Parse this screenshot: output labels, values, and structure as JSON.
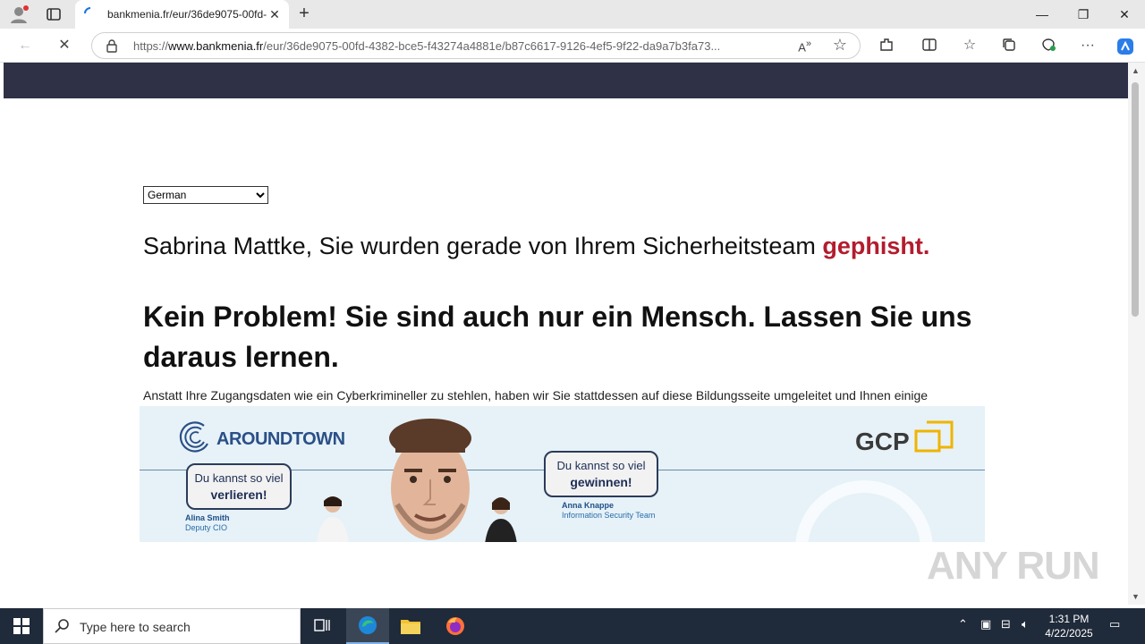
{
  "browser": {
    "tab_title": "bankmenia.fr/eur/36de9075-00fd-",
    "url_prefix": "https://",
    "url_domain": "www.bankmenia.fr",
    "url_path": "/eur/36de9075-00fd-4382-bce5-f43274a4881e/b87c6617-9126-4ef5-9f22-da9a7b3fa73...",
    "readaloud_label": "Á»"
  },
  "page": {
    "language_selected": "German",
    "language_options": [
      "German"
    ],
    "lead_text": "Sabrina Mattke, Sie wurden gerade von Ihrem Sicherheitsteam ",
    "lead_highlight": "gephisht.",
    "headline": "Kein Problem! Sie sind auch nur ein Mensch. Lassen Sie uns daraus lernen.",
    "body": "Anstatt Ihre Zugangsdaten wie ein Cyberkrimineller zu stehlen, haben wir Sie stattdessen auf diese Bildungsseite umgeleitet und Ihnen einige Schulungen zugewiesen."
  },
  "banner": {
    "logo_left": "AROUNDTOWN",
    "logo_right": "GCP",
    "bubble_left_line1": "Du kannst so viel",
    "bubble_left_line2": "verlieren!",
    "bubble_right_line1": "Du kannst so viel",
    "bubble_right_line2": "gewinnen!",
    "person_left_name": "Alina Smith",
    "person_left_role": "Deputy CIO",
    "person_right_name": "Anna Knappe",
    "person_right_role": "Information Security Team"
  },
  "watermark": "ANY RUN",
  "taskbar": {
    "search_placeholder": "Type here to search",
    "time": "1:31 PM",
    "date": "4/22/2025"
  },
  "colors": {
    "header": "#2f3146",
    "highlight": "#b31c2e",
    "taskbar": "#1f2a3a"
  }
}
